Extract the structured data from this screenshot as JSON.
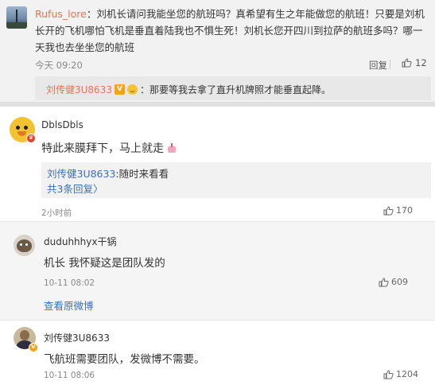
{
  "comments": [
    {
      "user": "Rufus_lore",
      "text": "刘机长请问我能坐您的航班吗？真希望有生之年能做您的航班！只要是刘机长开的飞机哪怕飞机是垂直着陆我也不惧生死！刘机长您开四川到拉萨的航班多吗？哪一天我也去坐坐您的航班",
      "time": "今天 09:20",
      "reply_label": "回复",
      "likes": "12",
      "sub_reply": {
        "user": "刘传健3U8633",
        "badge": "V",
        "text": "：那要等我去拿了直升机牌照才能垂直起降。"
      }
    },
    {
      "user": "DblsDbls",
      "text": "特此来膜拜下，马上就走",
      "sub_reply": {
        "user": "刘传健3U8633",
        "text": ":随时来看看",
        "more": "共3条回复",
        "more_arrow": "〉"
      },
      "time": "2小时前",
      "likes": "170"
    },
    {
      "user": "duduhhhyx干锅",
      "text": "机长 我怀疑这是团队发的",
      "time": "10-11 08:02",
      "likes": "609",
      "view_original": "查看原微博"
    },
    {
      "user": "刘传健3U8633",
      "text": "飞航班需要团队，发微博不需要。",
      "time": "10-11 08:06",
      "likes": "1204"
    }
  ],
  "colors": {
    "orange_name": "#eb7350",
    "link_blue": "#3b6fb6",
    "verified_orange": "#f2a31a"
  }
}
